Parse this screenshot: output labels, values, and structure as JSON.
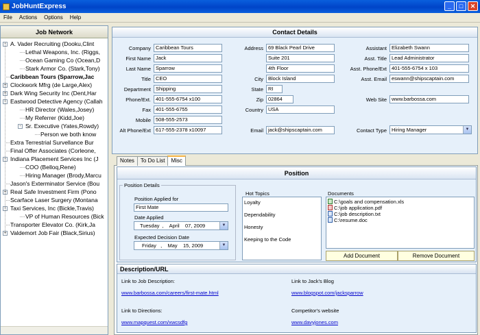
{
  "app": {
    "title": "JobHuntExpress"
  },
  "window": {
    "min": "_",
    "max": "□",
    "close": "✕"
  },
  "menu": [
    "File",
    "Actions",
    "Options",
    "Help"
  ],
  "tree": {
    "header": "Job Network",
    "items": [
      {
        "label": "A. Vader Recruiting (Dooku,Clint",
        "level": 0,
        "toggle": "-",
        "bold": false
      },
      {
        "label": "Lethal Weapons, Inc. (Riggs,",
        "level": 1,
        "toggle": "",
        "bold": false
      },
      {
        "label": "Ocean Gaming Co (Ocean,D",
        "level": 1,
        "toggle": "",
        "bold": false
      },
      {
        "label": "Stark Armor Co. (Stark,Tony)",
        "level": 1,
        "toggle": "",
        "bold": false
      },
      {
        "label": "Caribbean Tours (Sparrow,Jac",
        "level": 0,
        "toggle": "",
        "bold": true
      },
      {
        "label": "Clockwork Mfrg (de Large,Alex)",
        "level": 0,
        "toggle": "+",
        "bold": false
      },
      {
        "label": "Dark Wing Security Inc (Dent,Har",
        "level": 0,
        "toggle": "+",
        "bold": false
      },
      {
        "label": "Eastwood Detective Agency (Callah",
        "level": 0,
        "toggle": "-",
        "bold": false
      },
      {
        "label": "HR Director (Wales,Josey)",
        "level": 1,
        "toggle": "",
        "bold": false
      },
      {
        "label": "My Referrer (Kidd,Joe)",
        "level": 1,
        "toggle": "",
        "bold": false
      },
      {
        "label": "Sr. Executive (Yates,Rowdy)",
        "level": 1,
        "toggle": "-",
        "bold": false
      },
      {
        "label": "Person we both know",
        "level": 2,
        "toggle": "",
        "bold": false
      },
      {
        "label": "Extra Terrestrial Survellance Bur",
        "level": 0,
        "toggle": "",
        "bold": false
      },
      {
        "label": "Final Offer Associates (Corleone,",
        "level": 0,
        "toggle": "",
        "bold": false
      },
      {
        "label": "Indiana Placement Services Inc (J",
        "level": 0,
        "toggle": "-",
        "bold": false
      },
      {
        "label": "COO (Belloq,Rene)",
        "level": 1,
        "toggle": "",
        "bold": false
      },
      {
        "label": "Hiring Manager (Brody,Marcu",
        "level": 1,
        "toggle": "",
        "bold": false
      },
      {
        "label": "Jason's Exterminator Service (Bou",
        "level": 0,
        "toggle": "",
        "bold": false
      },
      {
        "label": "Real Safe Investment Firm (Pono",
        "level": 0,
        "toggle": "+",
        "bold": false
      },
      {
        "label": "Scarface Laser Surgery (Montana",
        "level": 0,
        "toggle": "",
        "bold": false
      },
      {
        "label": "Taxi Services, Inc (Bickle,Travis)",
        "level": 0,
        "toggle": "-",
        "bold": false
      },
      {
        "label": "VP of Human Resources (Bick",
        "level": 1,
        "toggle": "",
        "bold": false
      },
      {
        "label": "Transporter Elevator Co. (Kirk,Ja",
        "level": 0,
        "toggle": "",
        "bold": false
      },
      {
        "label": "Valdemort Job Fair (Black,Sirius)",
        "level": 0,
        "toggle": "+",
        "bold": false
      }
    ]
  },
  "contact": {
    "header": "Contact Details",
    "fields": {
      "company": {
        "label": "Company",
        "value": "Caribbean Tours"
      },
      "first_name": {
        "label": "First Name",
        "value": "Jack"
      },
      "last_name": {
        "label": "Last Name",
        "value": "Sparrow"
      },
      "title": {
        "label": "Title",
        "value": "CEO"
      },
      "department": {
        "label": "Department",
        "value": "Shipping"
      },
      "phone": {
        "label": "Phone/Ext.",
        "value": "401-555-6754 x100"
      },
      "fax": {
        "label": "Fax",
        "value": "401-555-6755"
      },
      "mobile": {
        "label": "Mobile",
        "value": "508-555-2573"
      },
      "alt_phone": {
        "label": "Alt Phone/Ext",
        "value": "617-555-2378 x10097"
      },
      "address": {
        "label": "Address",
        "value": "69 Black Pearl Drive"
      },
      "address2": {
        "value": "Suite 201"
      },
      "address3": {
        "value": "4th Floor"
      },
      "city": {
        "label": "City",
        "value": "Block Island"
      },
      "state": {
        "label": "State",
        "value": "RI"
      },
      "zip": {
        "label": "Zip",
        "value": "02864"
      },
      "country": {
        "label": "Country",
        "value": "USA"
      },
      "email": {
        "label": "Email",
        "value": "jack@shipscaptain.com"
      },
      "assistant": {
        "label": "Assistant",
        "value": "Elizabeth Swann"
      },
      "asst_title": {
        "label": "Asst. Title",
        "value": "Lead Administrator"
      },
      "asst_phone": {
        "label": "Asst. Phone/Ext",
        "value": "401-555-6754 x 103"
      },
      "asst_email": {
        "label": "Asst. Email",
        "value": "eswann@shipscaptain.com"
      },
      "web_site": {
        "label": "Web Site",
        "value": "www.barbossa.com"
      },
      "contact_type": {
        "label": "Contact Type",
        "value": "Hiring Manager"
      }
    }
  },
  "tabs": [
    "Notes",
    "To Do List",
    "Misc"
  ],
  "position": {
    "header": "Position",
    "details_title": "Position Details",
    "applied_for_label": "Position Applied for",
    "applied_for": "First Mate",
    "date_applied_label": "Date Applied",
    "date_applied": "Tuesday  ,    April    07, 2009",
    "decision_label": "Expected Decision Date",
    "decision_date": "Friday   ,    May    15, 2009",
    "hot_topics_title": "Hot Topics",
    "hot_topics": [
      "Loyalty",
      "Dependability",
      "Honesty",
      "Keeping to the Code"
    ],
    "documents_title": "Documents",
    "documents": [
      {
        "name": "C:\\goals and compensation.xls",
        "type": "xls"
      },
      {
        "name": "C:\\job application.pdf",
        "type": "pdf"
      },
      {
        "name": "C:\\job description.txt",
        "type": "txt"
      },
      {
        "name": "C:\\resume.doc",
        "type": "doc"
      }
    ],
    "add_doc": "Add Document",
    "remove_doc": "Remove Document"
  },
  "description": {
    "header": "Description/URL",
    "job_desc_label": "Link to Job Description:",
    "job_desc_url": "www.barbossa.com/careers/first-mate.html",
    "blog_label": "Link to Jack's Blog",
    "blog_url": "www.blogspot.com/jacksparrow",
    "directions_label": "Link to Directions:",
    "directions_url": "www.mapquest.com/xwcsdfg",
    "competitor_label": "Competitor's website",
    "competitor_url": "www.davyjones.com"
  }
}
